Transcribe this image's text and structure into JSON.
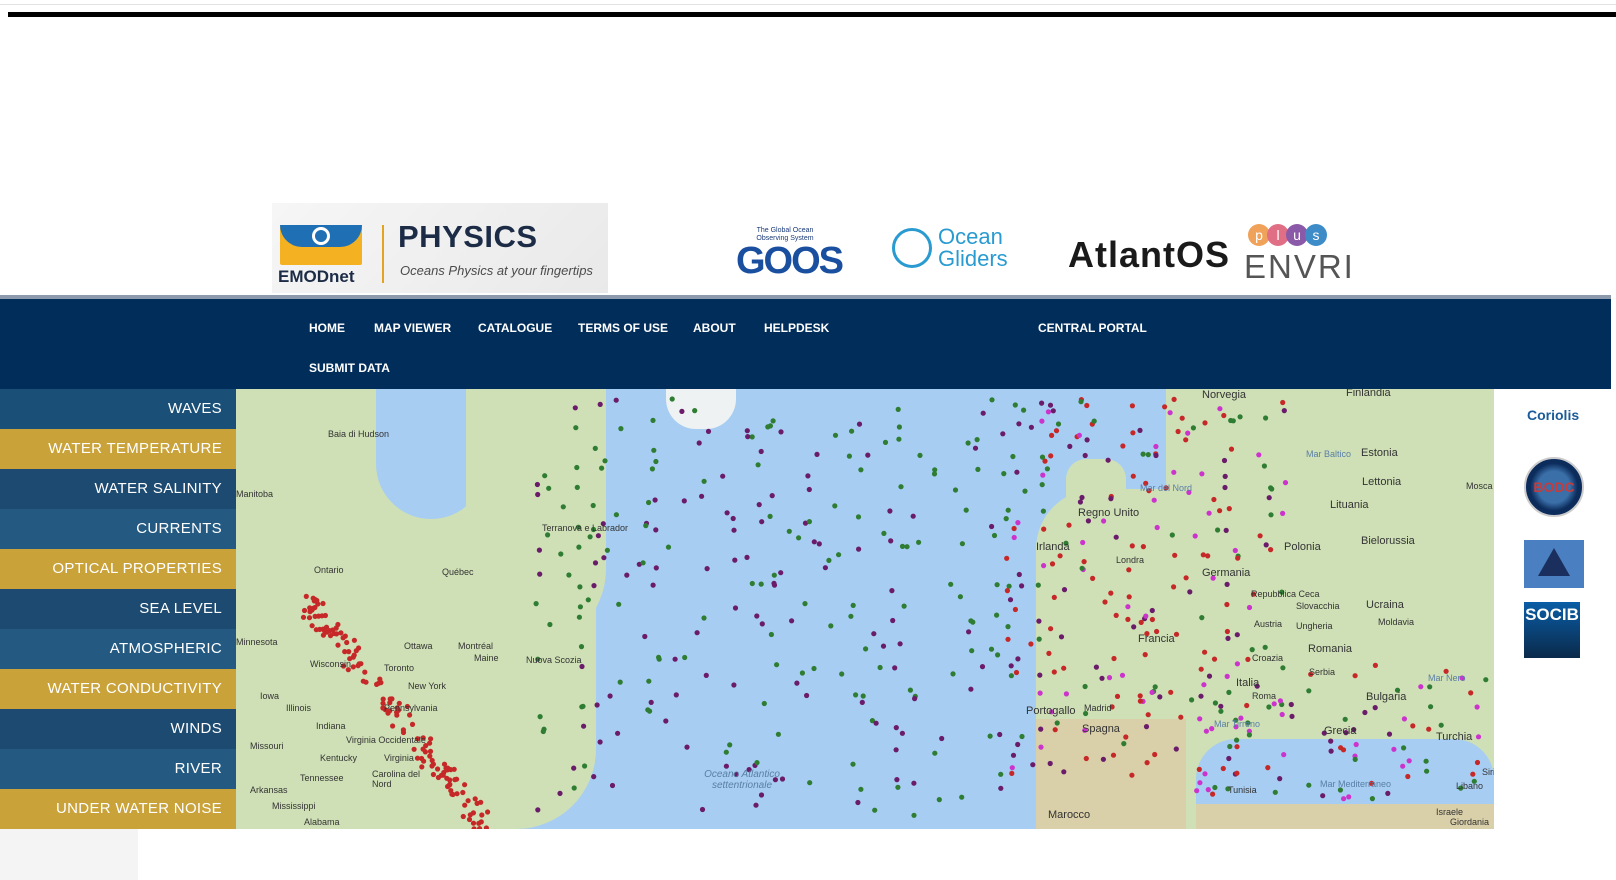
{
  "header": {
    "logo_text": "EMODnet",
    "title": "PHYSICS",
    "subtitle": "Oceans Physics at your fingertips"
  },
  "partners": {
    "goos_small": "The Global Ocean Observing System",
    "goos": "GOOS",
    "ocean_gliders": "Ocean Gliders",
    "atlantos": "AtlantOS",
    "plus_letters": [
      "p",
      "l",
      "u",
      "s"
    ],
    "envri": "ENVRI"
  },
  "nav": {
    "home": "HOME",
    "map_viewer": "MAP VIEWER",
    "catalogue": "CATALOGUE",
    "terms": "TERMS OF USE",
    "about": "ABOUT",
    "helpdesk": "HELPDESK",
    "central_portal": "CENTRAL PORTAL",
    "submit_data": "SUBMIT DATA"
  },
  "side_menu": [
    {
      "label": "WAVES",
      "color": "#1a4f77"
    },
    {
      "label": "WATER TEMPERATURE",
      "color": "#c9a23a"
    },
    {
      "label": "WATER SALINITY",
      "color": "#1d4a70"
    },
    {
      "label": "CURRENTS",
      "color": "#245a82"
    },
    {
      "label": "OPTICAL PROPERTIES",
      "color": "#c9a23a"
    },
    {
      "label": "SEA LEVEL",
      "color": "#1d4a70"
    },
    {
      "label": "ATMOSPHERIC",
      "color": "#245a82"
    },
    {
      "label": "WATER CONDUCTIVITY",
      "color": "#c9a23a"
    },
    {
      "label": "WINDS",
      "color": "#1d4a70"
    },
    {
      "label": "RIVER",
      "color": "#245a82"
    },
    {
      "label": "UNDER WATER NOISE",
      "color": "#c9a23a"
    }
  ],
  "map_labels": [
    "Norvegia",
    "Finlandia",
    "Baia di Hudson",
    "Estonia",
    "Lettonia",
    "Mosca",
    "Lituania",
    "Regno Unito",
    "Mar del Nord",
    "Mar Baltico",
    "Irlanda",
    "Polonia",
    "Bielorussia",
    "Germania",
    "Londra",
    "Terranova e Labrador",
    "Ontario",
    "Québec",
    "Repubblica Ceca",
    "Slovacchia",
    "Ucraina",
    "Francia",
    "Austria",
    "Ungheria",
    "Moldavia",
    "Minnesota",
    "Ottawa",
    "Montréal",
    "Maine",
    "Nuova Scozia",
    "Romania",
    "Croazia",
    "Serbia",
    "Wisconsin",
    "Toronto",
    "New York",
    "Italia",
    "Bulgaria",
    "Iowa",
    "Illinois",
    "Pennsylvania",
    "Portogallo",
    "Madrid",
    "Roma",
    "Mar Nero",
    "Spagna",
    "Mar Tirreno",
    "Grecia",
    "Turchia",
    "Indiana",
    "Virginia Occidentale",
    "Kentucky",
    "Virginia",
    "Missouri",
    "Tennessee",
    "Carolina del Nord",
    "Arkansas",
    "Mississippi",
    "Alabama",
    "Tunisia",
    "Mar Mediterraneo",
    "Libano",
    "Israele",
    "Giordania",
    "Marocco",
    "Oceano Atlantico settentrionale",
    "Siria",
    "Manitoba"
  ],
  "right_logos": {
    "coriolis": "Coriolis",
    "bodc": "BODC",
    "socib": "SOCIB"
  }
}
